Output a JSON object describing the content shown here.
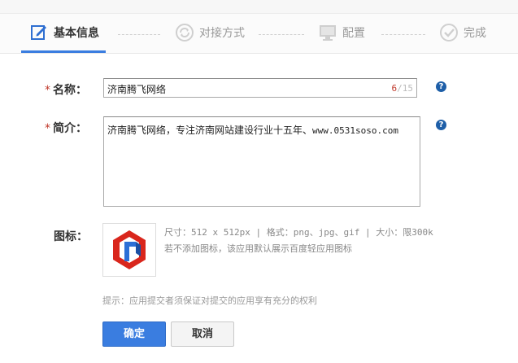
{
  "steps": [
    {
      "label": "基本信息",
      "active": true
    },
    {
      "label": "对接方式",
      "active": false
    },
    {
      "label": "配置",
      "active": false
    },
    {
      "label": "完成",
      "active": false
    }
  ],
  "form": {
    "name_label": "名称：",
    "name_value": "济南腾飞网络",
    "name_count_current": "6",
    "name_count_max": "/15",
    "intro_label": "简介：",
    "intro_value_cn": "济南腾飞网络，专注济南网站建设行业十五年、",
    "intro_value_en": "www.0531soso.com",
    "icon_label": "图标：",
    "icon_info_line1_prefix": "尺寸：",
    "icon_info_line1_size": "512 x 512px",
    "icon_info_line1_sep1": " | ",
    "icon_info_line1_format_label": "格式：",
    "icon_info_line1_formats": "png、jpg、gif",
    "icon_info_line1_sep2": " | ",
    "icon_info_line1_limit_label": "大小：",
    "icon_info_line1_limit": "限300k",
    "icon_info_line2": "若不添加图标，该应用默认展示百度轻应用图标",
    "tip": "提示：应用提交者须保证对提交的应用享有充分的权利",
    "star": "*",
    "help": "?"
  },
  "buttons": {
    "ok": "确定",
    "cancel": "取消"
  },
  "colors": {
    "accent": "#3a7de0",
    "required_star": "#c0392b",
    "help_icon": "#1e5fa8"
  }
}
